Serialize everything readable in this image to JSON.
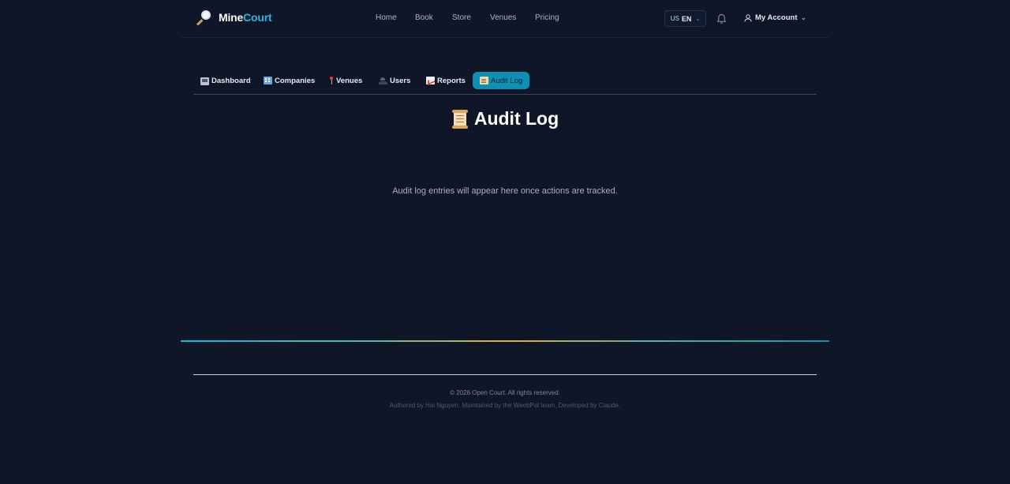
{
  "brand": {
    "part1": "Mine",
    "part2": "Court"
  },
  "nav": [
    {
      "label": "Home"
    },
    {
      "label": "Book"
    },
    {
      "label": "Store"
    },
    {
      "label": "Venues"
    },
    {
      "label": "Pricing"
    }
  ],
  "language": {
    "flag": "US",
    "code": "EN"
  },
  "account": {
    "label": "My Account"
  },
  "tabs": [
    {
      "label": "Dashboard",
      "icon": "computer-icon",
      "active": false
    },
    {
      "label": "Companies",
      "icon": "office-building-icon",
      "active": false
    },
    {
      "label": "Venues",
      "icon": "pushpin-icon",
      "active": false
    },
    {
      "label": "Users",
      "icon": "users-icon",
      "active": false
    },
    {
      "label": "Reports",
      "icon": "chart-increasing-icon",
      "active": false
    },
    {
      "label": "Audit Log",
      "icon": "scroll-icon",
      "active": true
    }
  ],
  "page": {
    "title": "Audit Log",
    "empty_message": "Audit log entries will appear here once actions are tracked."
  },
  "footer": {
    "copyright": "© 2026 Open Court. All rights reserved.",
    "credits": "Authored by Hai Nguyen, Maintained by the WeebPal team, Developed by Claude."
  },
  "colors": {
    "background": "#0e1628",
    "accent": "#22b8e0",
    "active_tab": "#0e8fb4"
  }
}
